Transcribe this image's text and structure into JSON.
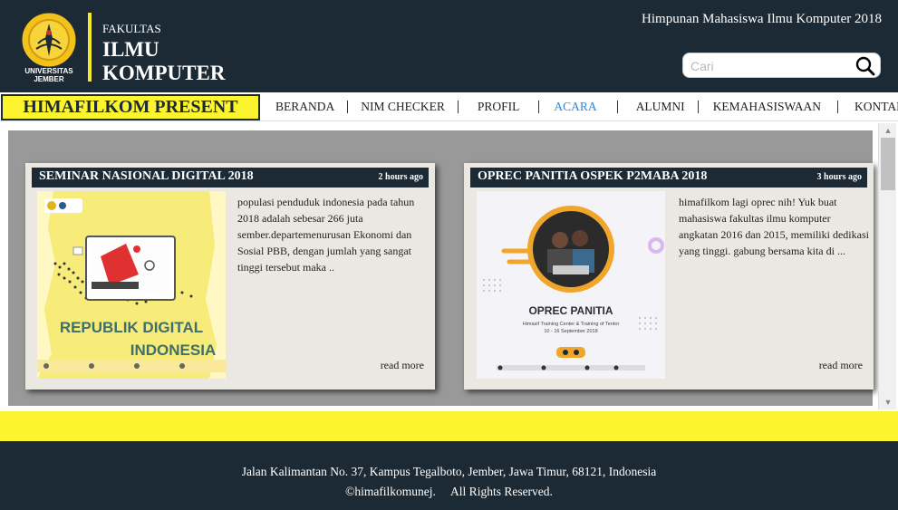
{
  "header": {
    "logo_caption": "UNIVERSITAS JEMBER",
    "faculty_small": "FAKULTAS",
    "faculty_line1": "ILMU",
    "faculty_line2": "KOMPUTER",
    "org_title": "Himpunan Mahasiswa Ilmu Komputer 2018",
    "search_placeholder": "Cari"
  },
  "navbar": {
    "brand": "HIMAFILKOM PRESENT",
    "items": [
      {
        "label": "BERANDA"
      },
      {
        "label": "NIM CHECKER"
      },
      {
        "label": "PROFIL"
      },
      {
        "label": "ACARA",
        "active": true
      },
      {
        "label": "ALUMNI"
      },
      {
        "label": "KEMAHASISWAAN"
      },
      {
        "label": "KONTAK"
      }
    ]
  },
  "cards": [
    {
      "title": "SEMINAR NASIONAL DIGITAL 2018",
      "time": "2 hours ago",
      "image_caption_1": "REPUBLIK DIGITAL",
      "image_caption_2": "INDONESIA",
      "text": "populasi penduduk indonesia pada tahun 2018 adalah sebesar 266 juta sember.departemenurusan Ekonomi dan Sosial PBB, dengan jumlah yang sangat tinggi tersebut maka ..",
      "read_more": "read more"
    },
    {
      "title": "OPREC PANITIA OSPEK P2MABA 2018",
      "time": "3 hours ago",
      "image_caption_1": "OPREC PANITIA",
      "image_caption_2": "Himasif Training Center & Training of Tentor",
      "image_caption_3": "10 - 16 September 2018",
      "text": "himafilkom lagi oprec nih! Yuk buat mahasiswa fakultas ilmu komputer angkatan 2016 dan 2015, memiliki dedikasi yang tinggi. gabung bersama kita di ...",
      "read_more": "read more"
    }
  ],
  "footer": {
    "address": "Jalan Kalimantan No. 37, Kampus Tegalboto, Jember, Jawa Timur, 68121, Indonesia",
    "copyright": "©himafilkomunej.     All Rights Reserved."
  },
  "colors": {
    "dark_navy": "#1c2a35",
    "yellow": "#fbf42e",
    "active_link": "#2e86d9",
    "card_bg": "#ebe8e2",
    "content_gray": "#999999"
  },
  "icons": [
    "university-logo",
    "search-icon",
    "scroll-up-arrow",
    "scroll-down-arrow"
  ]
}
